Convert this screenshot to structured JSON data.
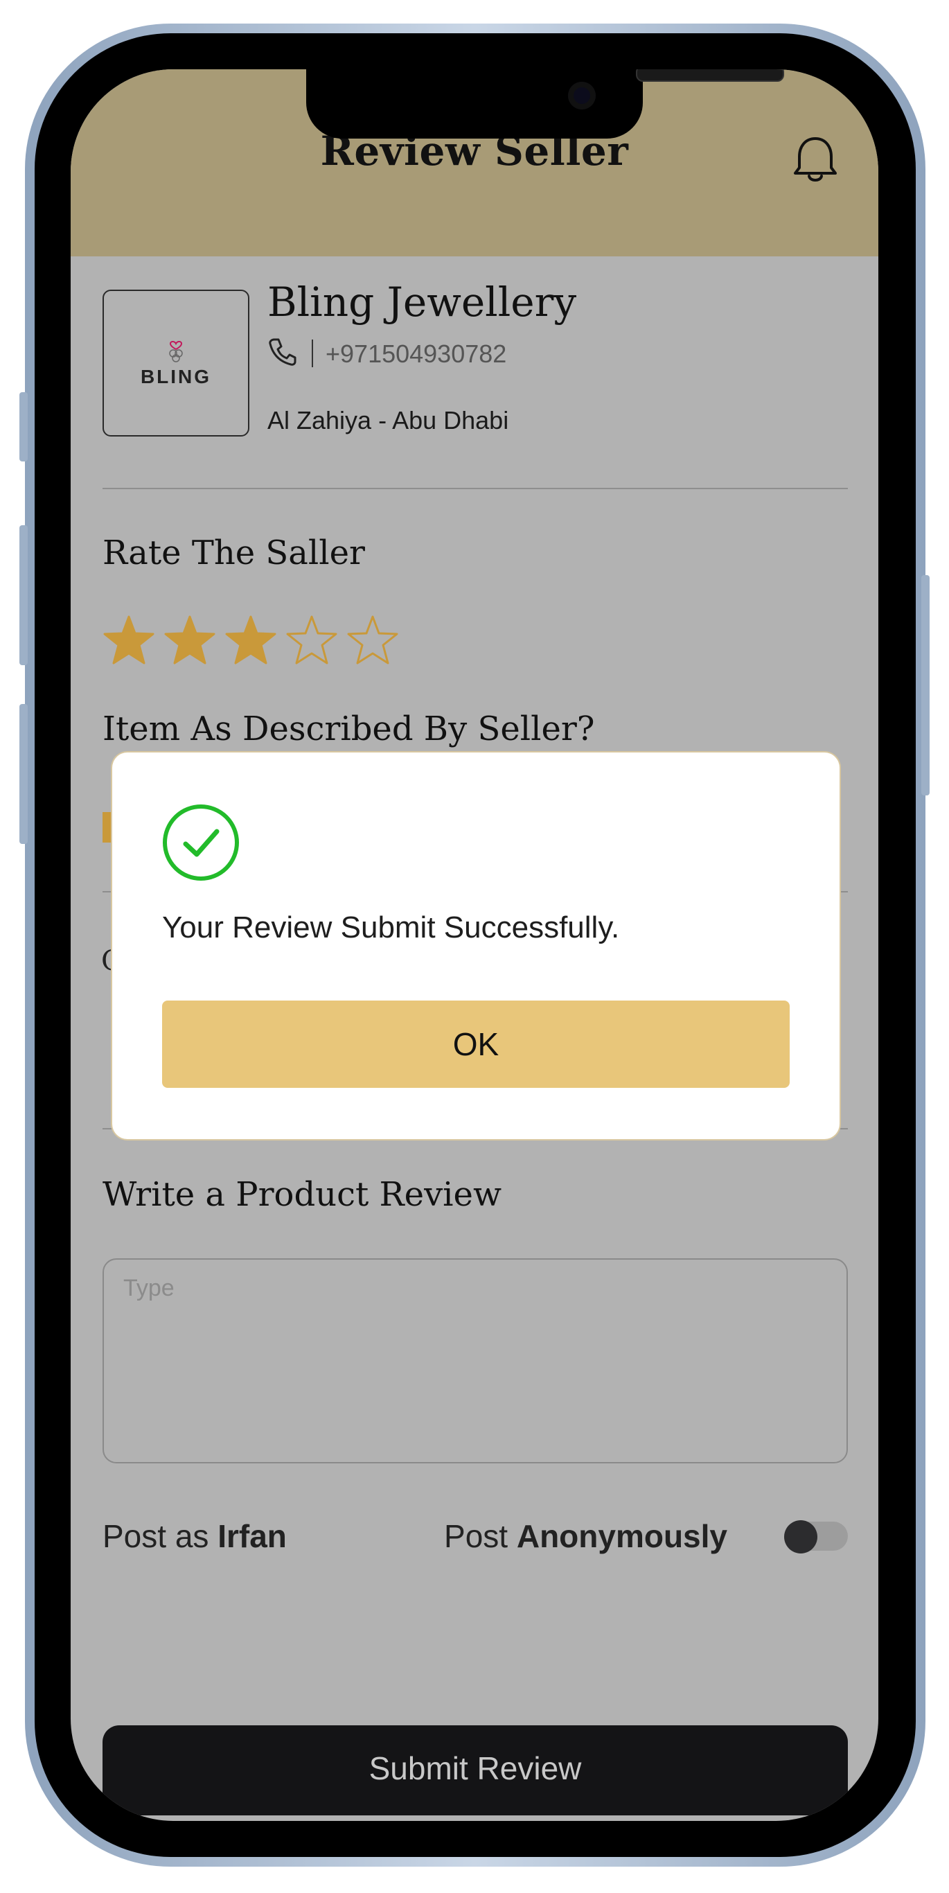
{
  "header": {
    "title": "Review Seller",
    "icon": "bell-icon"
  },
  "seller": {
    "logo_text": "BLING",
    "name": "Bling Jewellery",
    "phone": "+971504930782",
    "address": "Al Zahiya - Abu Dhabi"
  },
  "rating": {
    "label": "Rate The Saller",
    "value": 3,
    "max": 5,
    "color": "#c9993a"
  },
  "described": {
    "label": "Item As Described By Seller?"
  },
  "obscured_letter": "C",
  "review": {
    "label": "Write a Product Review",
    "placeholder": "Type"
  },
  "posting": {
    "post_as_prefix": "Post as",
    "user": "Irfan",
    "anon_prefix": "Post",
    "anon_label": "Anonymously",
    "anonymous": false
  },
  "submit_label": "Submit Review",
  "dialog": {
    "icon": "check-circle-icon",
    "message": "Your Review Submit Successfully.",
    "ok_label": "OK",
    "accent": "#22bb2a"
  },
  "colors": {
    "header": "#a89b76",
    "overlay_bg": "#b2b2b2",
    "ok_button": "#e8c67a"
  }
}
